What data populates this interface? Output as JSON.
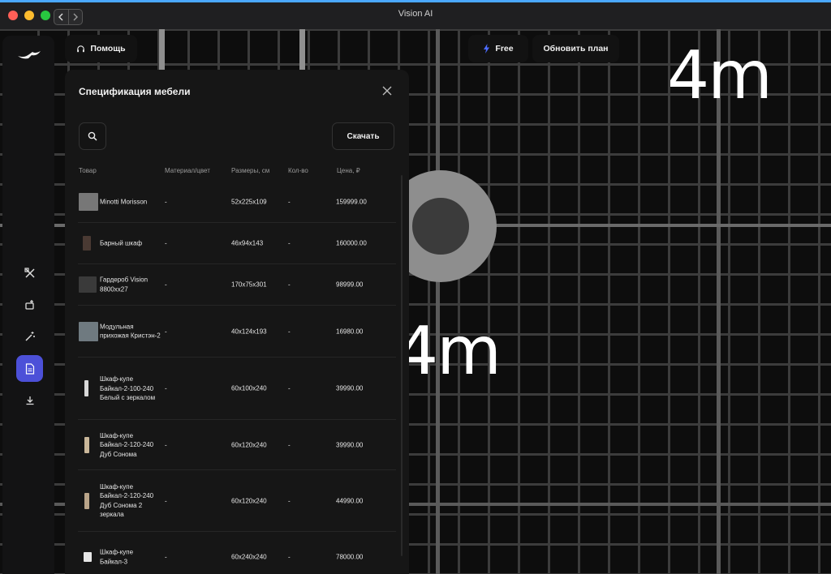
{
  "window": {
    "title": "Vision AI"
  },
  "canvas": {
    "label_top": "4m",
    "label_mid": "4m"
  },
  "top": {
    "help_label": "Помощь",
    "plan_badge": "Free",
    "upgrade_label": "Обновить план"
  },
  "panel": {
    "title": "Спецификация мебели",
    "download_label": "Скачать",
    "columns": {
      "item": "Товар",
      "material": "Материал/цвет",
      "size": "Размеры, см",
      "qty": "Кол-во",
      "price": "Цена, ₽"
    },
    "rows": [
      {
        "name": "Minotti Morisson",
        "material": "-",
        "size": "52x225x109",
        "qty": "-",
        "price": "159999.00"
      },
      {
        "name": "Барный шкаф",
        "material": "-",
        "size": "46x94x143",
        "qty": "-",
        "price": "160000.00"
      },
      {
        "name": "Гардероб Vision 8800xx27",
        "material": "-",
        "size": "170x75x301",
        "qty": "-",
        "price": "98999.00"
      },
      {
        "name": "Модульная прихожая Кристэн-2",
        "material": "-",
        "size": "40x124x193",
        "qty": "-",
        "price": "16980.00"
      },
      {
        "name": "Шкаф-купе Байкал-2-100-240 Белый с зеркалом",
        "material": "-",
        "size": "60x100x240",
        "qty": "-",
        "price": "39990.00"
      },
      {
        "name": "Шкаф-купе Байкал-2-120-240 Дуб Сонома",
        "material": "-",
        "size": "60x120x240",
        "qty": "-",
        "price": "39990.00"
      },
      {
        "name": "Шкаф-купе Байкал-2-120-240 Дуб Сонома 2 зеркала",
        "material": "-",
        "size": "60x120x240",
        "qty": "-",
        "price": "44990.00"
      },
      {
        "name": "Шкаф-купе Байкал-3",
        "material": "-",
        "size": "60x240x240",
        "qty": "-",
        "price": "78000.00"
      }
    ]
  },
  "sidebar": {
    "items": [
      {
        "icon": "tools-icon"
      },
      {
        "icon": "furniture-add-icon"
      },
      {
        "icon": "magic-wand-icon"
      },
      {
        "icon": "document-icon"
      },
      {
        "icon": "download-icon"
      }
    ]
  },
  "colors": {
    "accent": "#4c50d8",
    "title_bar_top": "#4aa8ff",
    "panel_bg": "#161616"
  }
}
